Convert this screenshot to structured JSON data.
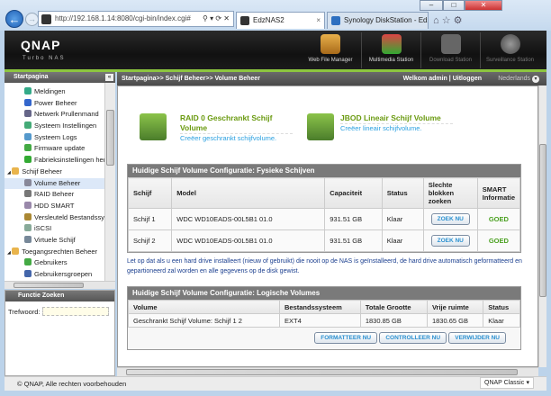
{
  "browser": {
    "url": "http://192.168.1.14:8080/cgi-bin/index.cgi#",
    "tabs": [
      {
        "label": "EdzNAS2",
        "active": true
      },
      {
        "label": "Synology DiskStation - EdzN..."
      }
    ],
    "window_controls": [
      "–",
      "□",
      "✕"
    ]
  },
  "header": {
    "logo": "QNAP",
    "sublogo": "Turbo NAS",
    "apps": [
      "Web File Manager",
      "Multimedia Station",
      "Download Station",
      "Surveillance Station"
    ]
  },
  "sidebar": {
    "title": "Startpagina",
    "items": [
      {
        "label": "Meldingen",
        "icon": "bell-icon",
        "level": 1
      },
      {
        "label": "Power Beheer",
        "icon": "power-icon",
        "level": 1
      },
      {
        "label": "Netwerk Prullenmand",
        "icon": "recycle-bin-icon",
        "level": 1
      },
      {
        "label": "Systeem Instellingen",
        "icon": "settings-icon",
        "level": 1
      },
      {
        "label": "Systeem Logs",
        "icon": "log-icon",
        "level": 1
      },
      {
        "label": "Firmware update",
        "icon": "firmware-icon",
        "level": 1
      },
      {
        "label": "Fabrieksinstellingen herstellen",
        "icon": "reset-icon",
        "level": 1
      },
      {
        "label": "Schijf Beheer",
        "icon": "folder-icon",
        "level": 0
      },
      {
        "label": "Volume Beheer",
        "icon": "volume-icon",
        "level": 1,
        "selected": true
      },
      {
        "label": "RAID Beheer",
        "icon": "raid-icon",
        "level": 1
      },
      {
        "label": "HDD SMART",
        "icon": "hdd-icon",
        "level": 1
      },
      {
        "label": "Versleuteld Bestandssysteem",
        "icon": "lock-icon",
        "level": 1
      },
      {
        "label": "iSCSI",
        "icon": "iscsi-icon",
        "level": 1
      },
      {
        "label": "Virtuele Schijf",
        "icon": "virtual-disk-icon",
        "level": 1
      },
      {
        "label": "Toegangsrechten Beheer",
        "icon": "folder-icon",
        "level": 0
      },
      {
        "label": "Gebruikers",
        "icon": "user-icon",
        "level": 1
      },
      {
        "label": "Gebruikersgroepen",
        "icon": "group-icon",
        "level": 1
      }
    ]
  },
  "search": {
    "title": "Functie Zoeken",
    "label": "Trefwoord:",
    "value": ""
  },
  "breadcrumb": "Startpagina>> Schijf Beheer>> Volume Beheer",
  "user": {
    "welcome": "Welkom admin",
    "separator": "|",
    "logout": "Uitloggen",
    "language": "Nederlands"
  },
  "create": [
    {
      "title": "RAID 0 Geschrankt Schijf Volume",
      "subtitle": "Creëer geschrankt schijfvolume."
    },
    {
      "title": "JBOD Lineair Schijf Volume",
      "subtitle": "Creëer lineair schijfvolume."
    }
  ],
  "physical": {
    "caption": "Huidige Schijf Volume Configuratie: Fysieke Schijven",
    "columns": [
      "Schijf",
      "Model",
      "Capaciteit",
      "Status",
      "Slechte blokken zoeken",
      "SMART Informatie"
    ],
    "rows": [
      {
        "disk": "Schijf 1",
        "model": "WDC WD10EADS-00L5B1 01.0",
        "capacity": "931.51 GB",
        "status": "Klaar",
        "action": "ZOEK NU",
        "smart": "GOED"
      },
      {
        "disk": "Schijf 2",
        "model": "WDC WD10EADS-00L5B1 01.0",
        "capacity": "931.51 GB",
        "status": "Klaar",
        "action": "ZOEK NU",
        "smart": "GOED"
      }
    ]
  },
  "note": "Let op dat als u een hard drive installeert (nieuw of gebruikt) die nooit op de NAS is geïnstalleerd, de hard drive automatisch geformatteerd en gepartioneerd zal worden en alle gegevens op de disk gewist.",
  "logical": {
    "caption": "Huidige Schijf Volume Configuratie: Logische Volumes",
    "columns": [
      "Volume",
      "Bestandssysteem",
      "Totale Grootte",
      "Vrije ruimte",
      "Status"
    ],
    "rows": [
      {
        "volume": "Geschrankt Schijf Volume: Schijf 1 2",
        "fs": "EXT4",
        "total": "1830.85 GB",
        "free": "1830.65 GB",
        "status": "Klaar"
      }
    ],
    "buttons": [
      "FORMATTEER NU",
      "CONTROLLEER NU",
      "VERWIJDER NU"
    ]
  },
  "footer": {
    "copyright": "© QNAP, Alle rechten voorbehouden",
    "skin": "QNAP Classic"
  }
}
